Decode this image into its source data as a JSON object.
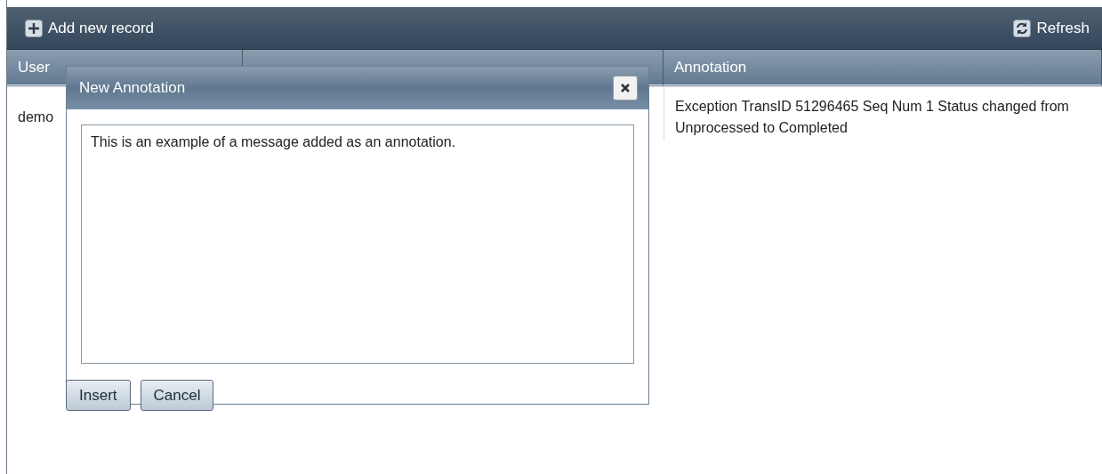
{
  "toolbar": {
    "add_button": "Add new record",
    "refresh_button": "Refresh"
  },
  "table": {
    "columns": [
      "User",
      null,
      "Annotation"
    ],
    "rows": [
      {
        "cells": [
          "demo",
          null,
          "Exception TransID 51296465 Seq Num 1 Status changed from Unprocessed to Completed"
        ]
      }
    ]
  },
  "dialog": {
    "title": "New Annotation",
    "message": "This is an example of a message added as an annotation.",
    "buttons": [
      "Insert",
      "Cancel"
    ]
  }
}
